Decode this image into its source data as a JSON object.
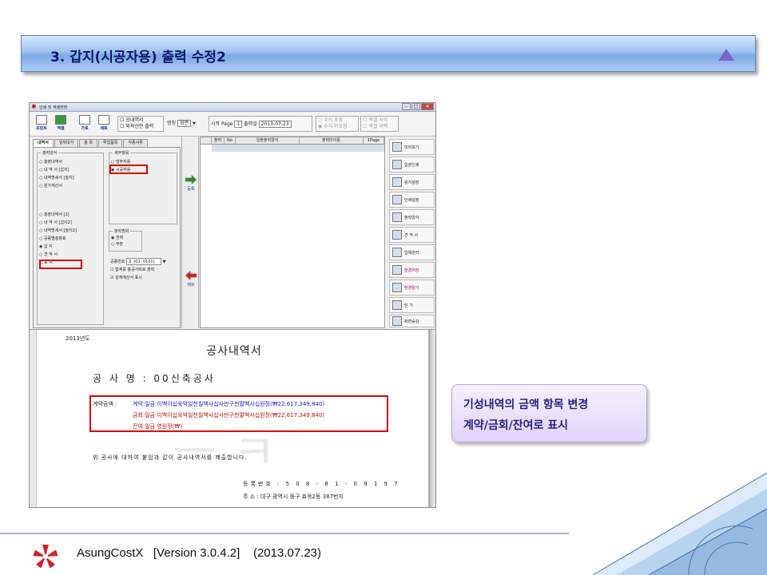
{
  "slide": {
    "title": "3. 갑지(시공자용) 출력 수정2",
    "callout_line1": "기성내역의 금액 항목 변경",
    "callout_line2": "계약/금회/잔여로 표시",
    "footer": "AsungCostX   [Version 3.0.4.2]    (2013.07.23)"
  },
  "app": {
    "window_title": "인쇄 및 엑셀변환",
    "toolbar": {
      "print": "프린트",
      "excel": "엑셀",
      "landscape": "가로",
      "portrait": "세로",
      "chk_gongnae": "공내역서",
      "chk_outline": "외곽선만 출력",
      "page_name_label": "명칭",
      "page_name_value": "화면",
      "start_page_label": "시작 Page",
      "start_page_value": "1",
      "print_date_label": "출력일",
      "print_date_value": "2013-07-23",
      "radio_formula1": "수식 포함",
      "radio_formula2": "수식 미포함",
      "chk_excel1": "엑셀 시작",
      "chk_excel2": "엑셀 이력"
    },
    "tabs": [
      "내역서",
      "일위대가",
      "총 목",
      "투입품목",
      "각종서류"
    ],
    "output_form": {
      "legend": "출력양식",
      "group1": [
        "총괄내역서",
        "내 역 서 [갑지]",
        "내역명세서 [을지]",
        "원가계산서"
      ],
      "group2": [
        "총괄내역서 [2]",
        "내 역 서 [갑지2]",
        "내역명세서 [을지2]",
        "공종별총괄표",
        "갑      지",
        "견  적  서",
        "표      지"
      ]
    },
    "detail_items": {
      "legend": "세부항목",
      "options": [
        "발주자용",
        "시공자용"
      ]
    },
    "print_range": {
      "legend": "출력범위",
      "options": [
        "전체",
        "부분"
      ]
    },
    "process_no_label": "공종번호",
    "process_no_value": "3. [01. 0101]",
    "chk_sum": "합계를 총공사비로 출력",
    "chk_design": "설계예산서 표시",
    "mid_add": "등록",
    "mid_remove": "제외",
    "grid_headers": [
      "출력",
      "No",
      "일괄출력양식",
      "출력타이틀",
      "1Page"
    ],
    "right_buttons": [
      "미리보기",
      "일괄인쇄",
      "용지설정",
      "인쇄설정",
      "출력양식",
      "견 적 서",
      "업체관리",
      "환경저장",
      "환경읽기",
      "닫   기",
      "화면숨김"
    ]
  },
  "preview": {
    "year": "2013년도",
    "doc_title": "공사내역서",
    "project": "공 사 명 : 00신축공사",
    "amount_label": "계약금액 :",
    "line_contract": "계약:일금 이백이십육억일천칠백사십사만구천팔백사십원정(₩22,617,349,840)",
    "line_current": "금회:일금 이백이십육억일천칠백사십사만구천팔백사십원정(₩22,617,349,840)",
    "line_remain": "잔여:일금 영원정(₩)",
    "statement": "위 공사에 대하여 붙임과 같이 공사내역서를 제출합니다.",
    "reg_no": "등록번호 : 5 0 8   -   8 1   -   0 9 1 9 7",
    "address": "주      소 : 대구 광역시  동구  효목2동 387번지"
  }
}
